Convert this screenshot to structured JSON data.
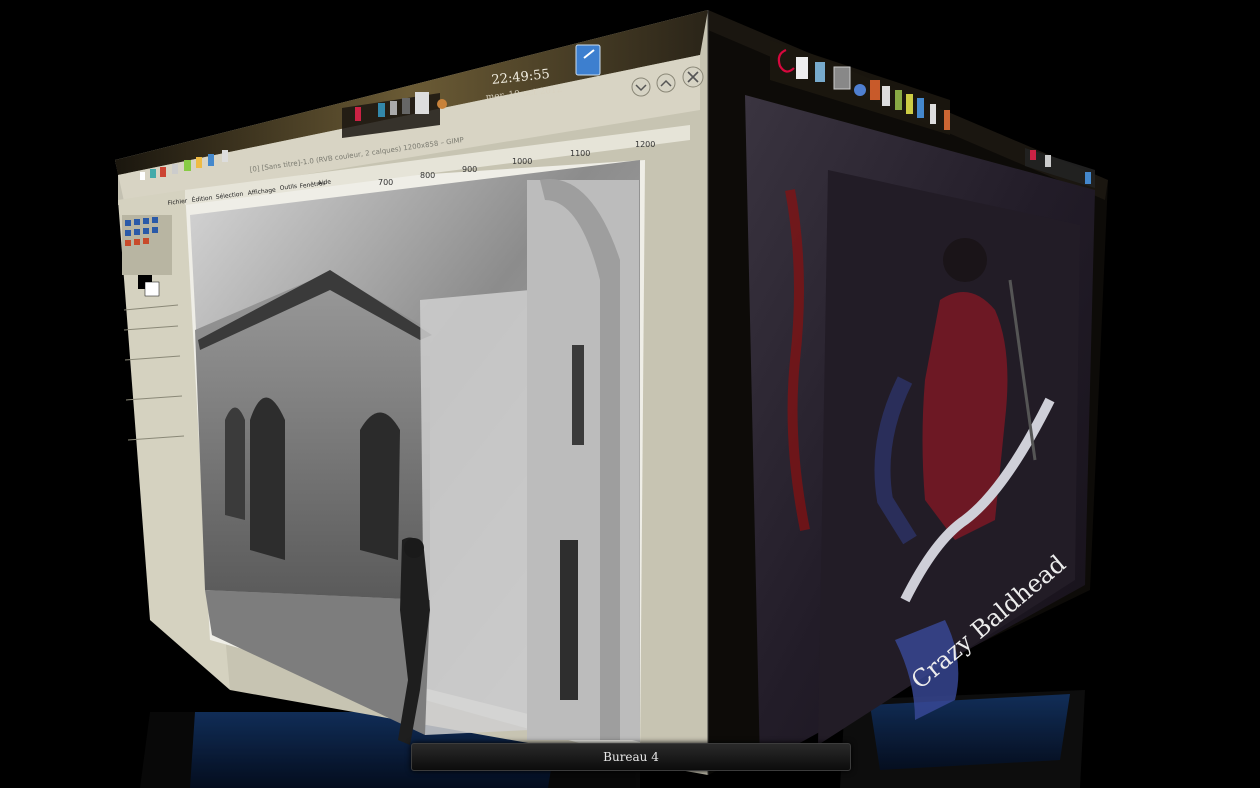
{
  "desktop_label": "Bureau 4",
  "clock": {
    "time": "22:49:55",
    "date": "mer. 10 oct 2012"
  },
  "gimp": {
    "title": "[0] [Sans titre]-1.0 (RVB couleur, 2 calques) 1200x858 – GIMP",
    "menu": [
      "Fichier",
      "Édition",
      "Sélection",
      "Affichage",
      "Image",
      "Calque",
      "Couleurs",
      "Outils",
      "Filtres",
      "Fenêtres",
      "Aide"
    ],
    "ruler_ticks": [
      "700",
      "800",
      "900",
      "1000",
      "1100",
      "1200"
    ]
  },
  "video": {
    "overlay_text": "Crazy Baldhead"
  },
  "window_buttons": [
    "minimize",
    "maximize",
    "close"
  ],
  "colors": {
    "panel": "#2b2416",
    "gimp_chrome": "#c9c6b4",
    "video_tint": "#2a2030",
    "reflection_blue": "#0d2a66"
  },
  "icons": [
    "debian-swirl-icon",
    "files-icon",
    "terminal-icon",
    "monitor-icon",
    "browser-icon",
    "network-icon",
    "audio-icon",
    "chat-icon",
    "office-icon",
    "show-desktop-icon"
  ]
}
